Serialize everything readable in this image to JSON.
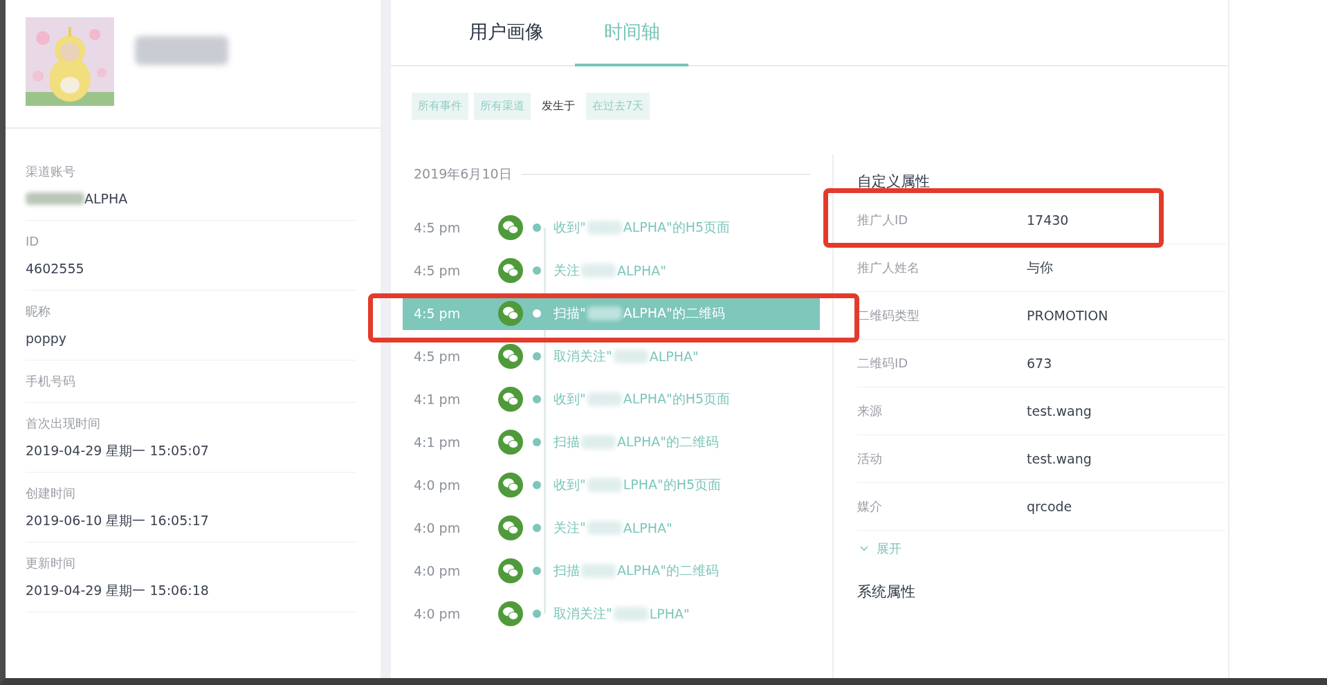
{
  "profile": {
    "fields": [
      {
        "label": "渠道账号",
        "value": "ALPHA",
        "redacted": true
      },
      {
        "label": "ID",
        "value": "4602555",
        "redacted": false
      },
      {
        "label": "昵称",
        "value": "poppy",
        "redacted": false
      },
      {
        "label": "手机号码",
        "redacted": false
      },
      {
        "label": "首次出现时间",
        "value": "2019-04-29 星期一 15:05:07",
        "redacted": false
      },
      {
        "label": "创建时间",
        "value": "2019-06-10 星期一 16:05:17",
        "redacted": false
      },
      {
        "label": "更新时间",
        "value": "2019-04-29 星期一 15:06:18",
        "redacted": false
      }
    ]
  },
  "tabs": [
    {
      "label": "用户画像",
      "selected": false
    },
    {
      "label": "时间轴",
      "selected": true
    }
  ],
  "filters": [
    {
      "kind": "chip",
      "label": "所有事件"
    },
    {
      "kind": "chip",
      "label": "所有渠道"
    },
    {
      "kind": "text",
      "label": "发生于"
    },
    {
      "kind": "chip",
      "label": "在过去7天"
    }
  ],
  "timeline": {
    "date": "2019年6月10日",
    "events": [
      {
        "time": "4:5 pm",
        "before": "收到\"",
        "after": "ALPHA\"的H5页面",
        "selected": false
      },
      {
        "time": "4:5 pm",
        "before": "关注",
        "after": "ALPHA\"",
        "selected": false
      },
      {
        "time": "4:5 pm",
        "before": "扫描\"",
        "after": "ALPHA\"的二维码",
        "selected": true
      },
      {
        "time": "4:5 pm",
        "before": "取消关注\"",
        "after": "ALPHA\"",
        "selected": false
      },
      {
        "time": "4:1 pm",
        "before": "收到\"",
        "after": "ALPHA\"的H5页面",
        "selected": false
      },
      {
        "time": "4:1 pm",
        "before": "扫描",
        "after": "ALPHA\"的二维码",
        "selected": false
      },
      {
        "time": "4:0 pm",
        "before": "收到\"",
        "after": "LPHA\"的H5页面",
        "selected": false
      },
      {
        "time": "4:0 pm",
        "before": "关注\"",
        "after": "ALPHA\"",
        "selected": false
      },
      {
        "time": "4:0 pm",
        "before": "扫描",
        "after": "ALPHA\"的二维码",
        "selected": false
      },
      {
        "time": "4:0 pm",
        "before": "取消关注\"",
        "after": "LPHA\"",
        "selected": false
      }
    ]
  },
  "properties": {
    "sections": [
      {
        "title": "自定义属性",
        "rows": [
          {
            "label": "推广人ID",
            "value": "17430"
          },
          {
            "label": "推广人姓名",
            "value": "与你"
          },
          {
            "label": "二维码类型",
            "value": "PROMOTION"
          },
          {
            "label": "二维码ID",
            "value": "673"
          },
          {
            "label": "来源",
            "value": "test.wang"
          },
          {
            "label": "活动",
            "value": "test.wang"
          },
          {
            "label": "媒介",
            "value": "qrcode"
          }
        ],
        "expand": "展开"
      },
      {
        "title": "系统属性"
      }
    ]
  }
}
